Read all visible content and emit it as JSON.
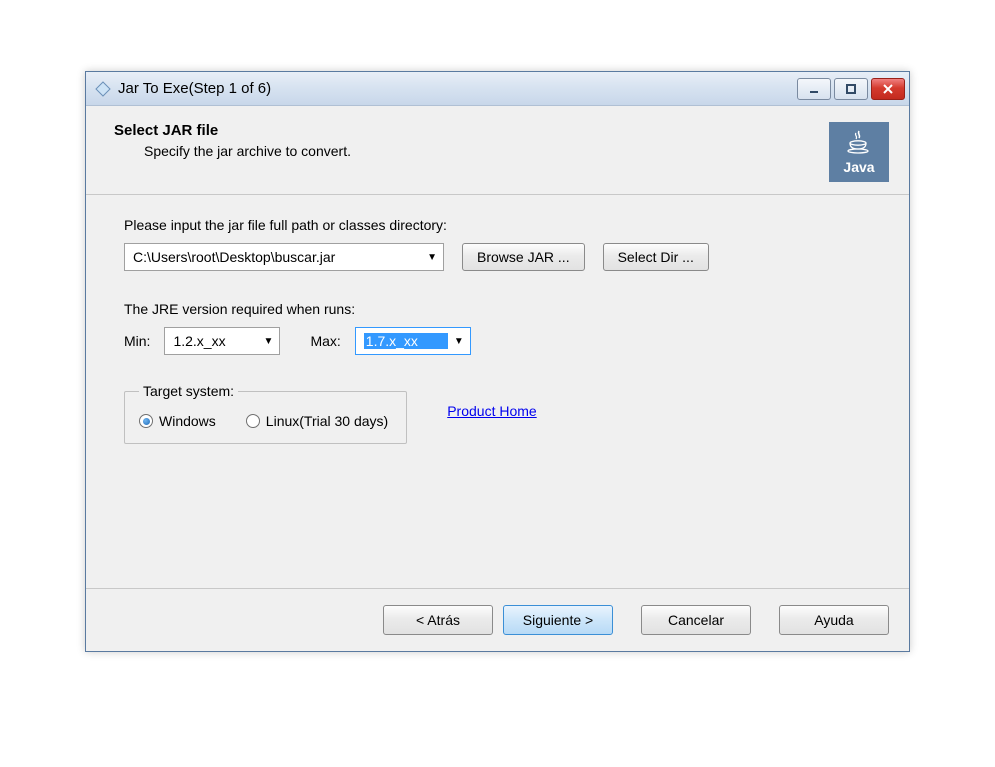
{
  "titlebar": {
    "title": "Jar To Exe(Step 1 of 6)"
  },
  "header": {
    "heading": "Select JAR file",
    "subheading": "Specify the jar archive to convert.",
    "logo_text": "Java"
  },
  "form": {
    "path_label": "Please input the jar file full path or classes directory:",
    "path_value": "C:\\Users\\root\\Desktop\\buscar.jar",
    "browse_jar": "Browse JAR ...",
    "select_dir": "Select Dir ...",
    "jre_label": "The JRE version required when runs:",
    "min_label": "Min:",
    "min_value": "1.2.x_xx",
    "max_label": "Max:",
    "max_value": "1.7.x_xx",
    "target_legend": "Target system:",
    "radio_windows": "Windows",
    "radio_linux": "Linux(Trial 30 days)",
    "product_home": "Product Home"
  },
  "footer": {
    "back": "< Atrás",
    "next": "Siguiente >",
    "cancel": "Cancelar",
    "help": "Ayuda"
  }
}
